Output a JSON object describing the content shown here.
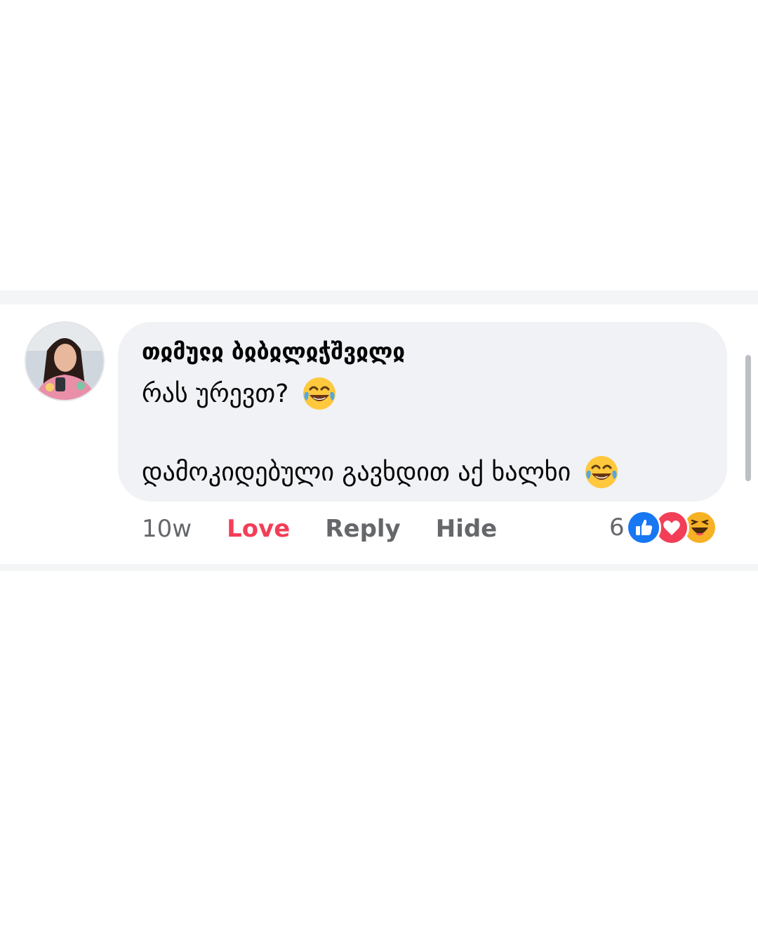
{
  "comment": {
    "author": "თჲმუჺჲ ბჲბჲლჲჭშვჲლჲ",
    "text_line_1": "რას ურევთ?",
    "text_line_2": "დამოკიდებული გავხდით აქ ხალხი",
    "emoji": "face-with-tears-of-joy",
    "actions": {
      "time": "10w",
      "love": "Love",
      "reply": "Reply",
      "hide": "Hide"
    },
    "reactions": {
      "count": "6",
      "types": [
        "like",
        "love",
        "haha"
      ]
    }
  },
  "colors": {
    "bubble": "#f0f2f5",
    "love_action": "#f33e58",
    "secondary_text": "#65676b",
    "like_blue": "#1877f2",
    "love_red": "#f33e58",
    "haha_yellow": "#f7b125"
  }
}
